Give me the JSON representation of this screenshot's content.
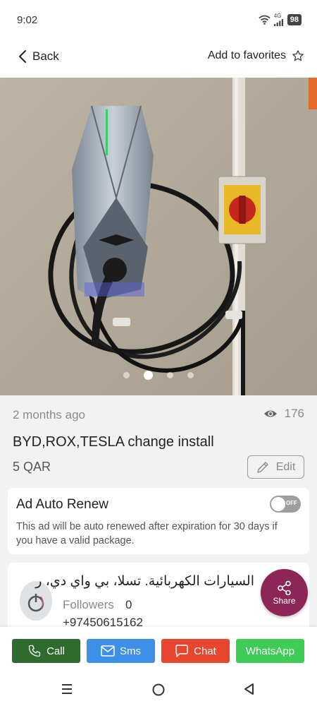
{
  "status_bar": {
    "time": "9:02",
    "network": "4G",
    "battery": "98"
  },
  "header": {
    "back_label": "Back",
    "favorites_label": "Add to favorites"
  },
  "gallery": {
    "slide_count": 4,
    "active_slide": 2
  },
  "listing": {
    "posted": "2 months ago",
    "views": "176",
    "title": "BYD,ROX,TESLA change install",
    "price": "5 QAR",
    "edit_label": "Edit"
  },
  "auto_renew": {
    "title": "Ad Auto Renew",
    "toggle_text": "OFF",
    "description": "This ad will be auto renewed after expiration for 30 days if you have a valid package."
  },
  "seller": {
    "name": "السيارات الكهربائية. تسلا، بي واي دي، ر",
    "followers_label": "Followers",
    "followers_count": "0",
    "phone": "+97450615162"
  },
  "share": {
    "label": "Share"
  },
  "actions": {
    "call": "Call",
    "sms": "Sms",
    "chat": "Chat",
    "whatsapp": "WhatsApp"
  },
  "colors": {
    "call": "#2e6b2e",
    "sms": "#3d8fe8",
    "chat": "#e8462f",
    "whatsapp": "#3ecb56",
    "share": "#8b2657"
  },
  "icons": [
    "wifi-icon",
    "signal-icon",
    "battery-icon",
    "back-chevron-icon",
    "star-icon",
    "eye-icon",
    "pencil-icon",
    "share-icon",
    "phone-icon",
    "envelope-icon",
    "chat-bubble-icon",
    "menu-icon",
    "home-circle-icon",
    "back-triangle-icon"
  ]
}
